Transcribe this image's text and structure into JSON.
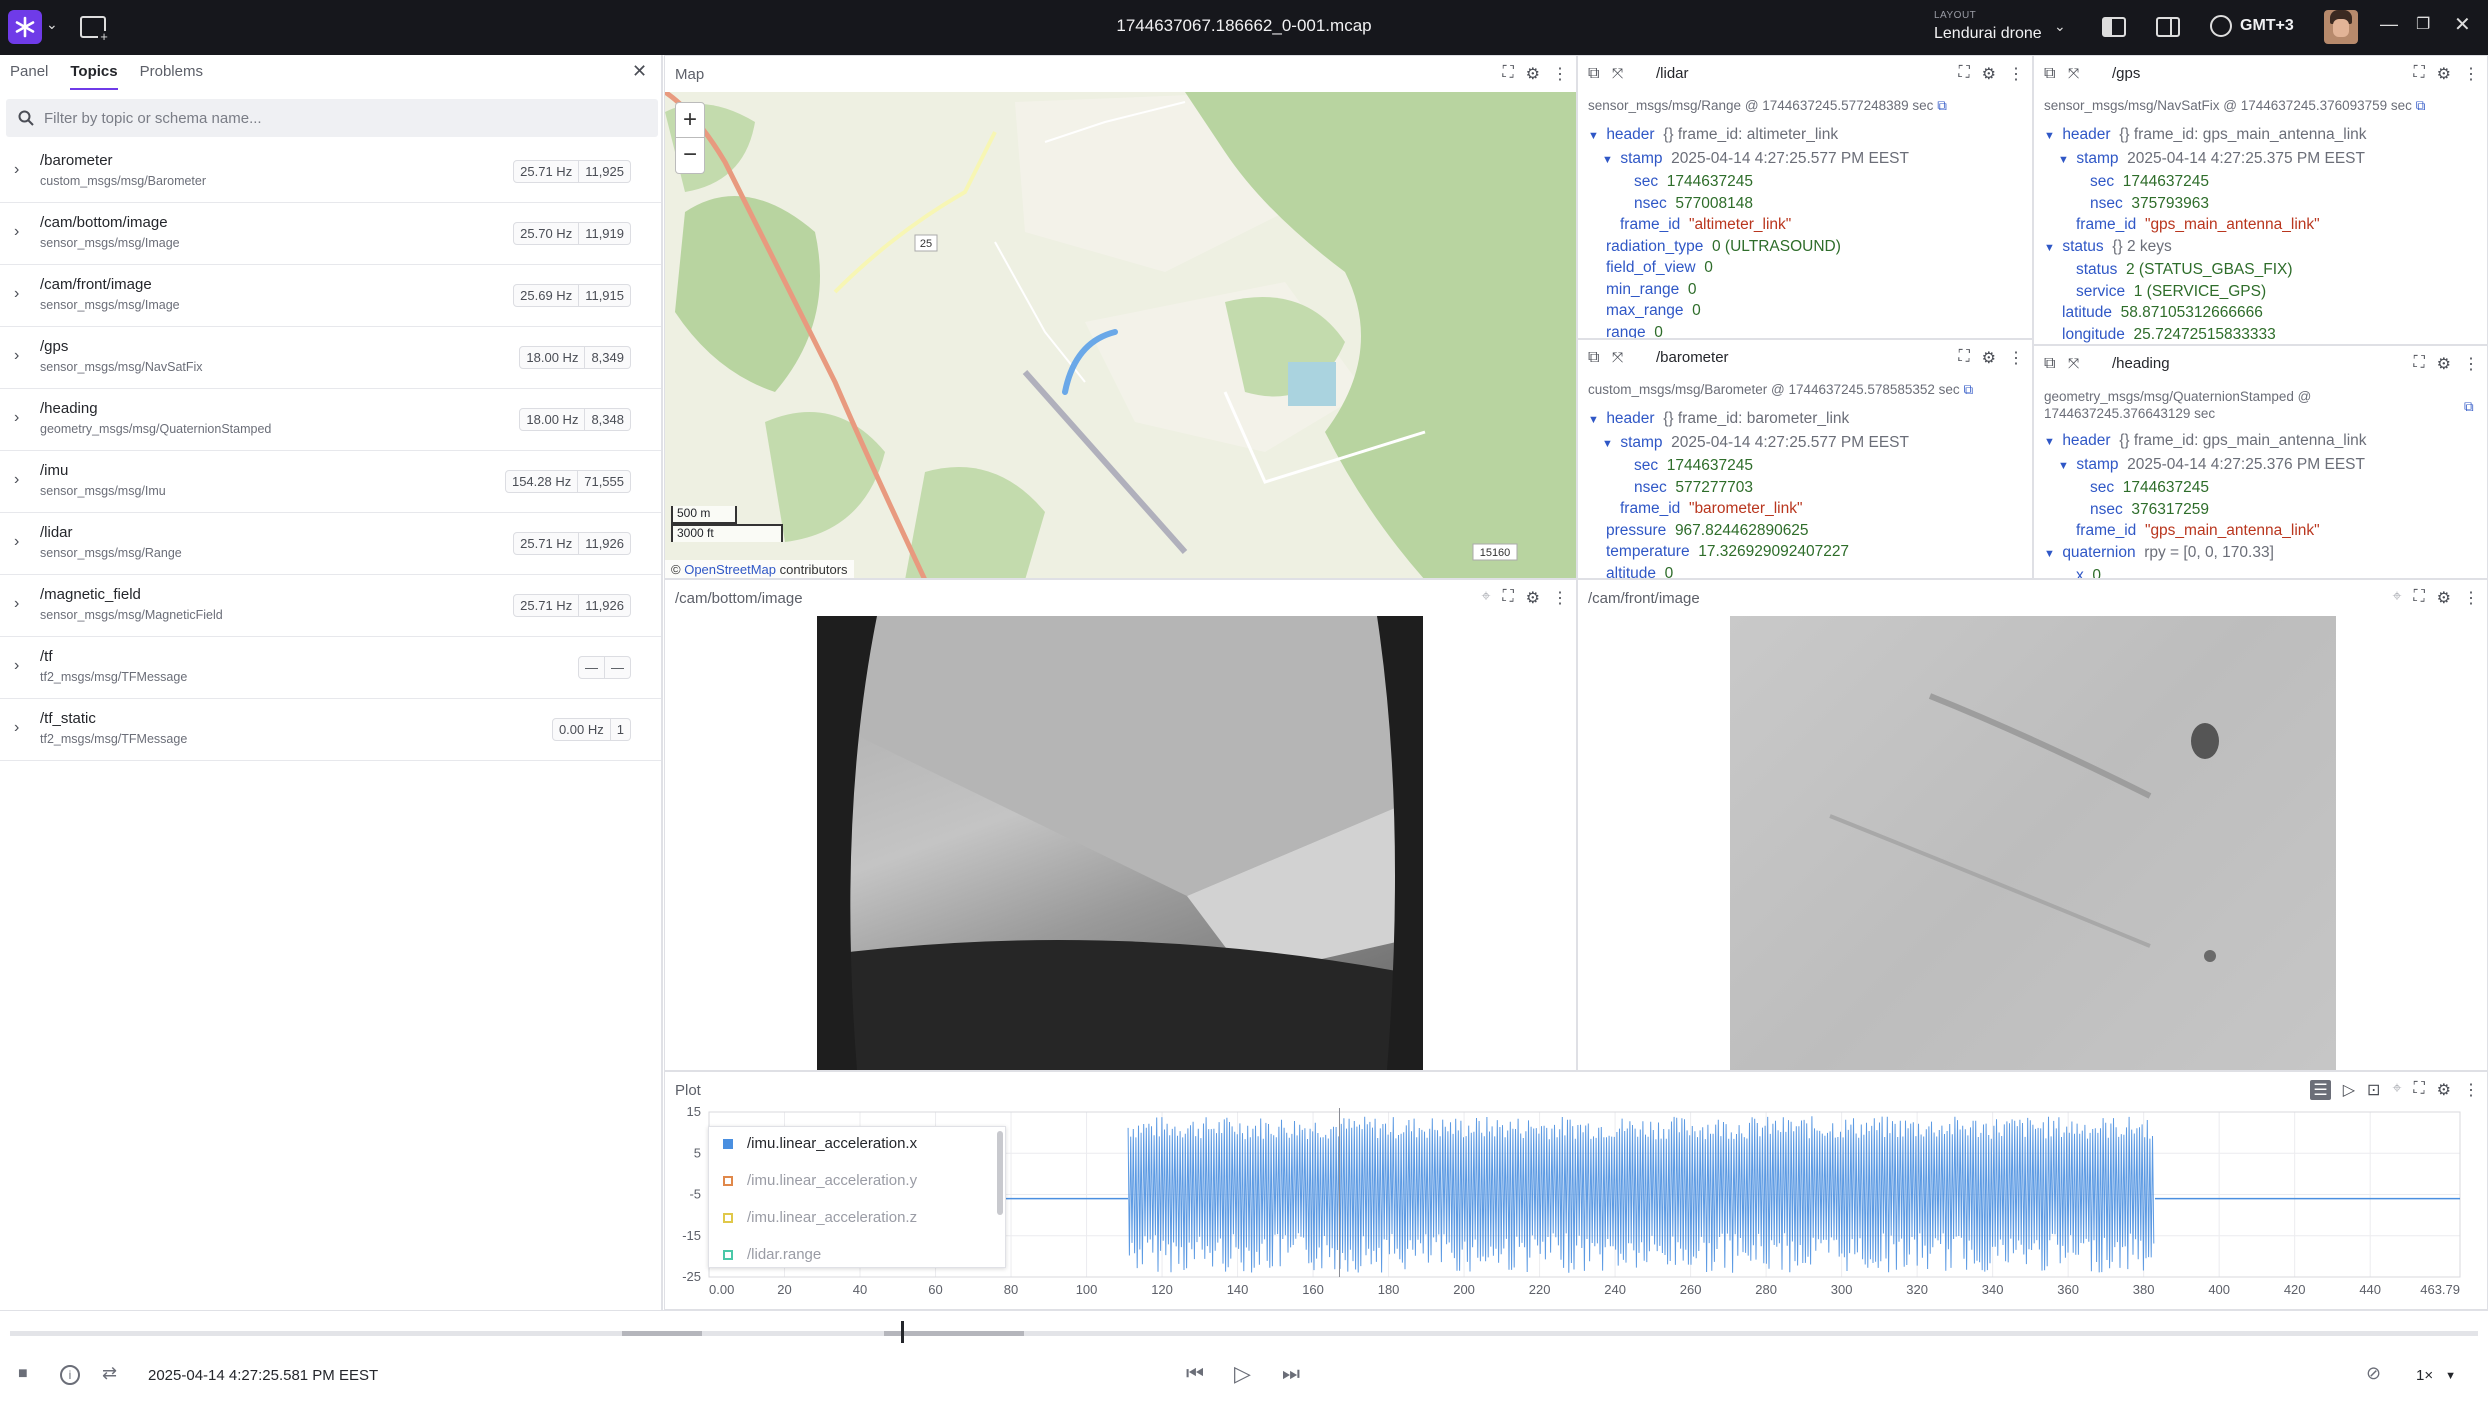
{
  "topbar": {
    "file_title": "1744637067.186662_0-001.mcap",
    "layout_caption": "LAYOUT",
    "layout_name": "Lendurai drone",
    "timezone": "GMT+3"
  },
  "left": {
    "tabs": [
      "Panel",
      "Topics",
      "Problems"
    ],
    "active_tab": "Topics",
    "search_placeholder": "Filter by topic or schema name...",
    "topics": [
      {
        "name": "/barometer",
        "schema": "custom_msgs/msg/Barometer",
        "hz": "25.71 Hz",
        "count": "11,925"
      },
      {
        "name": "/cam/bottom/image",
        "schema": "sensor_msgs/msg/Image",
        "hz": "25.70 Hz",
        "count": "11,919"
      },
      {
        "name": "/cam/front/image",
        "schema": "sensor_msgs/msg/Image",
        "hz": "25.69 Hz",
        "count": "11,915"
      },
      {
        "name": "/gps",
        "schema": "sensor_msgs/msg/NavSatFix",
        "hz": "18.00 Hz",
        "count": "8,349"
      },
      {
        "name": "/heading",
        "schema": "geometry_msgs/msg/QuaternionStamped",
        "hz": "18.00 Hz",
        "count": "8,348"
      },
      {
        "name": "/imu",
        "schema": "sensor_msgs/msg/Imu",
        "hz": "154.28 Hz",
        "count": "71,555"
      },
      {
        "name": "/lidar",
        "schema": "sensor_msgs/msg/Range",
        "hz": "25.71 Hz",
        "count": "11,926"
      },
      {
        "name": "/magnetic_field",
        "schema": "sensor_msgs/msg/MagneticField",
        "hz": "25.71 Hz",
        "count": "11,926"
      },
      {
        "name": "/tf",
        "schema": "tf2_msgs/msg/TFMessage",
        "hz": "—",
        "count": "—"
      },
      {
        "name": "/tf_static",
        "schema": "tf2_msgs/msg/TFMessage",
        "hz": "0.00 Hz",
        "count": "1"
      }
    ]
  },
  "map": {
    "title": "Map",
    "zoom_in": "+",
    "zoom_out": "−",
    "scale_m": "500 m",
    "scale_ft": "3000 ft",
    "attribution_prefix": "©",
    "attribution_link": "OpenStreetMap",
    "attribution_suffix": "contributors",
    "road_label_1": "25",
    "road_label_2": "15160"
  },
  "lidar": {
    "title": "/lidar",
    "schema": "sensor_msgs/msg/Range @ 1744637245.577248389 sec",
    "header_key": "header",
    "header_val": "{} frame_id: altimeter_link",
    "stamp_key": "stamp",
    "stamp_val": "2025-04-14 4:27:25.577 PM EEST",
    "sec_key": "sec",
    "sec_val": "1744637245",
    "nsec_key": "nsec",
    "nsec_val": "577008148",
    "frame_key": "frame_id",
    "frame_val": "\"altimeter_link\"",
    "radiation_key": "radiation_type",
    "radiation_val": "0 (ULTRASOUND)",
    "fov_key": "field_of_view",
    "fov_val": "0",
    "min_key": "min_range",
    "min_val": "0",
    "max_key": "max_range",
    "max_val": "0",
    "range_key": "range",
    "range_val": "0"
  },
  "gps": {
    "title": "/gps",
    "schema": "sensor_msgs/msg/NavSatFix @ 1744637245.376093759 sec",
    "header_key": "header",
    "header_val": "{} frame_id: gps_main_antenna_link",
    "stamp_key": "stamp",
    "stamp_val": "2025-04-14 4:27:25.375 PM EEST",
    "sec_key": "sec",
    "sec_val": "1744637245",
    "nsec_key": "nsec",
    "nsec_val": "375793963",
    "frame_key": "frame_id",
    "frame_val": "\"gps_main_antenna_link\"",
    "status_key": "status",
    "status_val": "{} 2 keys",
    "status2_key": "status",
    "status2_val": "2 (STATUS_GBAS_FIX)",
    "service_key": "service",
    "service_val": "1 (SERVICE_GPS)",
    "lat_key": "latitude",
    "lat_val": "58.87105312666666",
    "lon_key": "longitude",
    "lon_val": "25.72472515833333"
  },
  "barometer": {
    "title": "/barometer",
    "schema": "custom_msgs/msg/Barometer @ 1744637245.578585352 sec",
    "header_key": "header",
    "header_val": "{} frame_id: barometer_link",
    "stamp_key": "stamp",
    "stamp_val": "2025-04-14 4:27:25.577 PM EEST",
    "sec_key": "sec",
    "sec_val": "1744637245",
    "nsec_key": "nsec",
    "nsec_val": "577277703",
    "frame_key": "frame_id",
    "frame_val": "\"barometer_link\"",
    "pressure_key": "pressure",
    "pressure_val": "967.824462890625",
    "temp_key": "temperature",
    "temp_val": "17.326929092407227",
    "alt_key": "altitude",
    "alt_val": "0"
  },
  "heading": {
    "title": "/heading",
    "schema_1": "geometry_msgs/msg/QuaternionStamped @",
    "schema_2": "1744637245.376643129 sec",
    "header_key": "header",
    "header_val": "{} frame_id: gps_main_antenna_link",
    "stamp_key": "stamp",
    "stamp_val": "2025-04-14 4:27:25.376 PM EEST",
    "sec_key": "sec",
    "sec_val": "1744637245",
    "nsec_key": "nsec",
    "nsec_val": "376317259",
    "frame_key": "frame_id",
    "frame_val": "\"gps_main_antenna_link\"",
    "quat_key": "quaternion",
    "quat_val": "rpy = [0, 0, 170.33]",
    "x_key": "x",
    "x_val": "0"
  },
  "cam_bottom": {
    "title": "/cam/bottom/image"
  },
  "cam_front": {
    "title": "/cam/front/image"
  },
  "plot": {
    "title": "Plot"
  },
  "chart_data": {
    "type": "line",
    "series": [
      {
        "name": "/imu.linear_acceleration.x",
        "color": "#4a8fe0",
        "visible": true
      },
      {
        "name": "/imu.linear_acceleration.y",
        "color": "#e0884a",
        "visible": false
      },
      {
        "name": "/imu.linear_acceleration.z",
        "color": "#e0c84a",
        "visible": false
      },
      {
        "name": "/lidar.range",
        "color": "#4ac8a8",
        "visible": false
      }
    ],
    "x_ticks": [
      "0.00",
      "20",
      "40",
      "60",
      "80",
      "100",
      "120",
      "140",
      "160",
      "180",
      "200",
      "220",
      "240",
      "260",
      "280",
      "300",
      "320",
      "340",
      "360",
      "380",
      "400",
      "420",
      "440",
      "463.79"
    ],
    "y_ticks": [
      "15",
      "5",
      "-5",
      "-15",
      "-25"
    ],
    "xlim": [
      0,
      463.79
    ],
    "ylim": [
      -25,
      15
    ],
    "flat_segments": [
      {
        "x0": 0,
        "x1": 111,
        "y": -6
      },
      {
        "x0": 383,
        "x1": 463.79,
        "y": -6
      }
    ],
    "noise_segment": {
      "x0": 111,
      "x1": 383,
      "ymin": -24,
      "ymax": 14
    },
    "cursor_x": 167
  },
  "bottom": {
    "timestamp": "2025-04-14 4:27:25.581 PM EEST",
    "speed": "1×",
    "progress": 0.361
  }
}
